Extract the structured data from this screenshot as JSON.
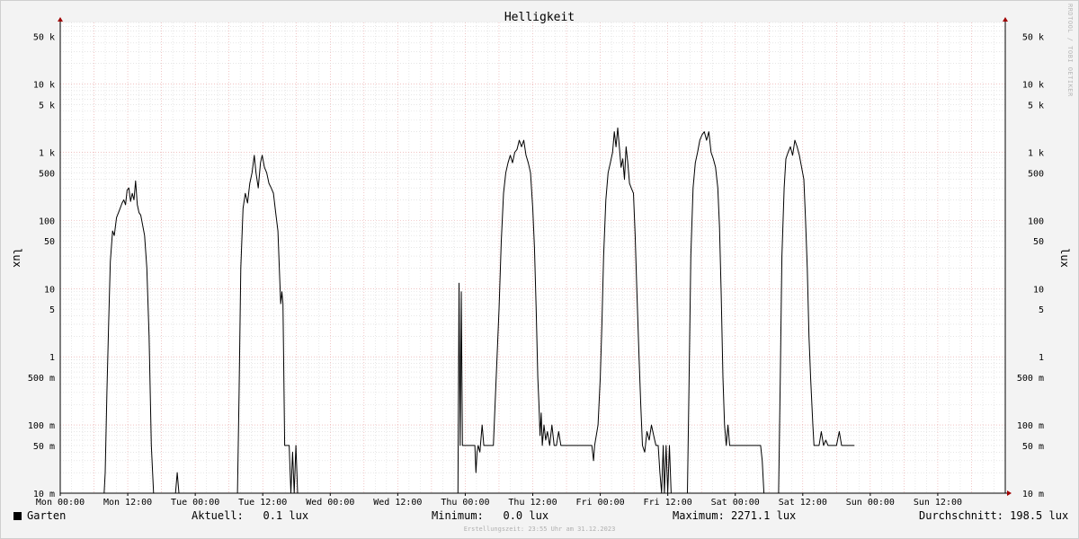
{
  "chart_data": {
    "type": "line",
    "title": "Helligkeit",
    "ylabel": "lux",
    "yscale": "log",
    "ylim": [
      0.01,
      80000
    ],
    "y_tick_labels": [
      {
        "value": 50000,
        "label": "50 k"
      },
      {
        "value": 10000,
        "label": "10 k"
      },
      {
        "value": 5000,
        "label": "5 k"
      },
      {
        "value": 1000,
        "label": "1 k"
      },
      {
        "value": 500,
        "label": "500"
      },
      {
        "value": 100,
        "label": "100"
      },
      {
        "value": 50,
        "label": "50"
      },
      {
        "value": 10,
        "label": "10"
      },
      {
        "value": 5,
        "label": "5"
      },
      {
        "value": 1,
        "label": "1"
      },
      {
        "value": 0.5,
        "label": "500 m"
      },
      {
        "value": 0.1,
        "label": "100 m"
      },
      {
        "value": 0.05,
        "label": "50 m"
      },
      {
        "value": 0.01,
        "label": "10 m"
      }
    ],
    "x_unit": "hours since Mon 00:00",
    "xlim": [
      0,
      168
    ],
    "x_tick_labels": [
      {
        "x": 0,
        "label": "Mon 00:00"
      },
      {
        "x": 12,
        "label": "Mon 12:00"
      },
      {
        "x": 24,
        "label": "Tue 00:00"
      },
      {
        "x": 36,
        "label": "Tue 12:00"
      },
      {
        "x": 48,
        "label": "Wed 00:00"
      },
      {
        "x": 60,
        "label": "Wed 12:00"
      },
      {
        "x": 72,
        "label": "Thu 00:00"
      },
      {
        "x": 84,
        "label": "Thu 12:00"
      },
      {
        "x": 96,
        "label": "Fri 00:00"
      },
      {
        "x": 108,
        "label": "Fri 12:00"
      },
      {
        "x": 120,
        "label": "Sat 00:00"
      },
      {
        "x": 132,
        "label": "Sat 12:00"
      },
      {
        "x": 144,
        "label": "Sun 00:00"
      },
      {
        "x": 156,
        "label": "Sun 12:00"
      }
    ],
    "grid": true,
    "series": [
      {
        "name": "Garten",
        "color": "#000000",
        "points": [
          [
            0,
            0.01
          ],
          [
            7.8,
            0.01
          ],
          [
            8.0,
            0.02
          ],
          [
            8.3,
            0.3
          ],
          [
            8.6,
            3
          ],
          [
            8.9,
            25
          ],
          [
            9.3,
            70
          ],
          [
            9.6,
            60
          ],
          [
            10.0,
            110
          ],
          [
            10.5,
            140
          ],
          [
            11.0,
            180
          ],
          [
            11.3,
            200
          ],
          [
            11.6,
            170
          ],
          [
            11.9,
            280
          ],
          [
            12.2,
            300
          ],
          [
            12.5,
            190
          ],
          [
            12.8,
            250
          ],
          [
            13.1,
            200
          ],
          [
            13.4,
            380
          ],
          [
            13.7,
            170
          ],
          [
            14.0,
            130
          ],
          [
            14.3,
            120
          ],
          [
            14.6,
            90
          ],
          [
            15.0,
            60
          ],
          [
            15.4,
            20
          ],
          [
            15.8,
            2
          ],
          [
            16.2,
            0.05
          ],
          [
            16.6,
            0.01
          ],
          [
            20.5,
            0.01
          ],
          [
            20.8,
            0.02
          ],
          [
            21.1,
            0.01
          ],
          [
            31.5,
            0.01
          ],
          [
            31.8,
            0.3
          ],
          [
            32.1,
            20
          ],
          [
            32.5,
            150
          ],
          [
            32.9,
            250
          ],
          [
            33.3,
            180
          ],
          [
            33.7,
            350
          ],
          [
            34.1,
            500
          ],
          [
            34.5,
            900
          ],
          [
            34.8,
            500
          ],
          [
            35.2,
            300
          ],
          [
            35.6,
            700
          ],
          [
            35.9,
            900
          ],
          [
            36.3,
            600
          ],
          [
            36.7,
            500
          ],
          [
            37.1,
            350
          ],
          [
            37.5,
            300
          ],
          [
            37.9,
            250
          ],
          [
            38.3,
            130
          ],
          [
            38.7,
            70
          ],
          [
            39.0,
            15
          ],
          [
            39.2,
            6
          ],
          [
            39.4,
            9
          ],
          [
            39.6,
            6
          ],
          [
            39.9,
            0.05
          ],
          [
            40.3,
            0.05
          ],
          [
            40.7,
            0.05
          ],
          [
            41.0,
            0.01
          ],
          [
            41.3,
            0.04
          ],
          [
            41.6,
            0.01
          ],
          [
            41.9,
            0.05
          ],
          [
            42.2,
            0.01
          ],
          [
            70.7,
            0.01
          ],
          [
            70.9,
            12
          ],
          [
            71.1,
            0.05
          ],
          [
            71.3,
            9
          ],
          [
            71.5,
            0.05
          ],
          [
            72.0,
            0.05
          ],
          [
            73.0,
            0.05
          ],
          [
            73.7,
            0.05
          ],
          [
            73.9,
            0.02
          ],
          [
            74.1,
            0.04
          ],
          [
            74.3,
            0.05
          ],
          [
            74.6,
            0.04
          ],
          [
            75.0,
            0.1
          ],
          [
            75.3,
            0.05
          ],
          [
            76.0,
            0.05
          ],
          [
            77.0,
            0.05
          ],
          [
            78.0,
            5
          ],
          [
            78.4,
            50
          ],
          [
            78.8,
            250
          ],
          [
            79.2,
            500
          ],
          [
            79.6,
            700
          ],
          [
            80.0,
            900
          ],
          [
            80.4,
            700
          ],
          [
            80.8,
            1000
          ],
          [
            81.2,
            1100
          ],
          [
            81.6,
            1500
          ],
          [
            82.0,
            1200
          ],
          [
            82.4,
            1500
          ],
          [
            82.8,
            900
          ],
          [
            83.2,
            700
          ],
          [
            83.6,
            500
          ],
          [
            84.0,
            150
          ],
          [
            84.3,
            40
          ],
          [
            84.6,
            5
          ],
          [
            84.9,
            0.5
          ],
          [
            85.1,
            0.2
          ],
          [
            85.3,
            0.07
          ],
          [
            85.5,
            0.15
          ],
          [
            85.7,
            0.05
          ],
          [
            86.0,
            0.1
          ],
          [
            86.3,
            0.06
          ],
          [
            86.6,
            0.08
          ],
          [
            87.0,
            0.05
          ],
          [
            87.4,
            0.1
          ],
          [
            87.8,
            0.05
          ],
          [
            88.2,
            0.05
          ],
          [
            88.6,
            0.08
          ],
          [
            89.0,
            0.05
          ],
          [
            89.4,
            0.05
          ],
          [
            90.0,
            0.05
          ],
          [
            91.0,
            0.05
          ],
          [
            92.0,
            0.05
          ],
          [
            93.0,
            0.05
          ],
          [
            94.0,
            0.05
          ],
          [
            94.5,
            0.05
          ],
          [
            94.8,
            0.03
          ],
          [
            95.0,
            0.05
          ],
          [
            95.6,
            0.1
          ],
          [
            96.0,
            0.5
          ],
          [
            96.3,
            3
          ],
          [
            96.6,
            30
          ],
          [
            97.0,
            200
          ],
          [
            97.4,
            500
          ],
          [
            97.8,
            700
          ],
          [
            98.2,
            1000
          ],
          [
            98.5,
            2000
          ],
          [
            98.8,
            1200
          ],
          [
            99.1,
            2271.1
          ],
          [
            99.4,
            1200
          ],
          [
            99.7,
            600
          ],
          [
            100.0,
            800
          ],
          [
            100.3,
            400
          ],
          [
            100.6,
            1200
          ],
          [
            100.9,
            700
          ],
          [
            101.2,
            350
          ],
          [
            101.5,
            300
          ],
          [
            101.9,
            250
          ],
          [
            102.2,
            60
          ],
          [
            102.5,
            10
          ],
          [
            102.9,
            1
          ],
          [
            103.2,
            0.2
          ],
          [
            103.5,
            0.05
          ],
          [
            103.9,
            0.04
          ],
          [
            104.3,
            0.08
          ],
          [
            104.7,
            0.06
          ],
          [
            105.1,
            0.1
          ],
          [
            105.5,
            0.07
          ],
          [
            105.9,
            0.05
          ],
          [
            106.3,
            0.05
          ],
          [
            106.6,
            0.02
          ],
          [
            106.9,
            0.01
          ],
          [
            107.2,
            0.05
          ],
          [
            107.4,
            0.01
          ],
          [
            107.7,
            0.05
          ],
          [
            108.0,
            0.01
          ],
          [
            108.3,
            0.05
          ],
          [
            108.6,
            0.01
          ],
          [
            111.5,
            0.01
          ],
          [
            111.8,
            0.5
          ],
          [
            112.1,
            30
          ],
          [
            112.5,
            300
          ],
          [
            112.9,
            700
          ],
          [
            113.3,
            1000
          ],
          [
            113.7,
            1500
          ],
          [
            114.1,
            1800
          ],
          [
            114.5,
            2000
          ],
          [
            114.9,
            1500
          ],
          [
            115.3,
            2000
          ],
          [
            115.7,
            1000
          ],
          [
            116.1,
            800
          ],
          [
            116.5,
            600
          ],
          [
            116.9,
            300
          ],
          [
            117.2,
            80
          ],
          [
            117.5,
            8
          ],
          [
            117.8,
            0.5
          ],
          [
            118.1,
            0.1
          ],
          [
            118.4,
            0.05
          ],
          [
            118.7,
            0.1
          ],
          [
            119.0,
            0.05
          ],
          [
            120.0,
            0.05
          ],
          [
            121.0,
            0.05
          ],
          [
            122.0,
            0.05
          ],
          [
            123.0,
            0.05
          ],
          [
            124.0,
            0.05
          ],
          [
            124.5,
            0.05
          ],
          [
            124.8,
            0.03
          ],
          [
            125.1,
            0.01
          ],
          [
            127.7,
            0.01
          ],
          [
            128.0,
            0.5
          ],
          [
            128.3,
            30
          ],
          [
            128.7,
            300
          ],
          [
            129.0,
            800
          ],
          [
            129.4,
            1000
          ],
          [
            129.8,
            1200
          ],
          [
            130.2,
            900
          ],
          [
            130.6,
            1500
          ],
          [
            131.0,
            1200
          ],
          [
            131.4,
            900
          ],
          [
            131.8,
            600
          ],
          [
            132.2,
            400
          ],
          [
            132.5,
            100
          ],
          [
            132.8,
            20
          ],
          [
            133.1,
            2
          ],
          [
            133.4,
            0.5
          ],
          [
            133.8,
            0.1
          ],
          [
            134.0,
            0.05
          ],
          [
            134.3,
            0.05
          ],
          [
            134.6,
            0.05
          ],
          [
            134.9,
            0.05
          ],
          [
            135.3,
            0.08
          ],
          [
            135.7,
            0.05
          ],
          [
            136.1,
            0.06
          ],
          [
            136.5,
            0.05
          ],
          [
            137.0,
            0.05
          ],
          [
            137.5,
            0.05
          ],
          [
            138.0,
            0.05
          ],
          [
            138.5,
            0.08
          ],
          [
            138.9,
            0.05
          ],
          [
            139.2,
            0.05
          ],
          [
            139.6,
            0.05
          ],
          [
            140.0,
            0.05
          ],
          [
            140.4,
            0.05
          ],
          [
            140.8,
            0.05
          ],
          [
            141.2,
            0.05
          ]
        ]
      }
    ]
  },
  "watermark": "RRDTOOL / TOBI OETIKER",
  "legend": {
    "series_name": "Garten",
    "current_label": "Aktuell:",
    "current_value": "0.1 lux",
    "min_label": "Minimum:",
    "min_value": "0.0 lux",
    "max_label": "Maximum:",
    "max_value": "2271.1 lux",
    "avg_label": "Durchschnitt:",
    "avg_value": "198.5 lux"
  },
  "footer": "Erstellungszeit: 23:55 Uhr am 31.12.2023"
}
